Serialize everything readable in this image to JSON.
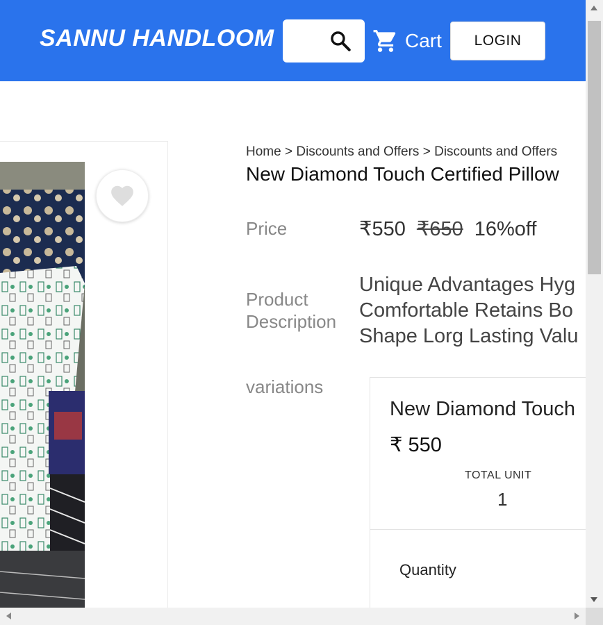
{
  "header": {
    "brand": "SANNU HANDLOOM",
    "cart_label": "Cart",
    "login_label": "LOGIN",
    "icons": {
      "search": "search-icon",
      "cart": "cart-icon"
    }
  },
  "image_card": {
    "wishlist_icon": "heart-icon"
  },
  "breadcrumb": {
    "home": "Home",
    "sep1": ">",
    "crumb1": "Discounts and Offers",
    "sep2": ">",
    "crumb2": "Discounts and Offers"
  },
  "product": {
    "title": "New Diamond Touch Certified Pillow",
    "price_label": "Price",
    "price": "₹550",
    "mrp": "₹650",
    "discount": "16%off",
    "description_label_line1": "Product",
    "description_label_line2": "Description",
    "description_line1": "Unique Advantages Hyg",
    "description_line2": "Comfortable Retains Bo",
    "description_line3": "Shape Lorg Lasting Valu",
    "variations_label": "variations"
  },
  "variation": {
    "name": "New Diamond Touch",
    "price": "₹ 550",
    "total_unit_label": "TOTAL UNIT",
    "total_unit_value": "1",
    "quantity_label": "Quantity"
  },
  "colors": {
    "header_bg": "#2a73ec",
    "heart": "#dedede"
  }
}
